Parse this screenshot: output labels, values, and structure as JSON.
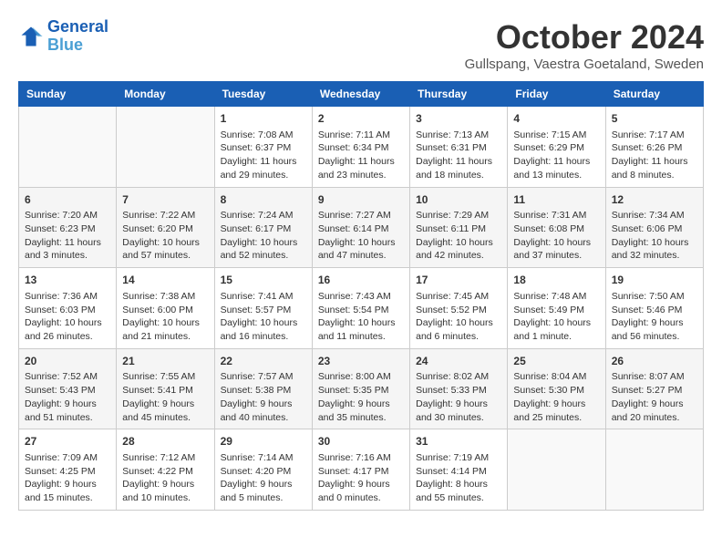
{
  "header": {
    "logo_line1": "General",
    "logo_line2": "Blue",
    "month": "October 2024",
    "location": "Gullspang, Vaestra Goetaland, Sweden"
  },
  "weekdays": [
    "Sunday",
    "Monday",
    "Tuesday",
    "Wednesday",
    "Thursday",
    "Friday",
    "Saturday"
  ],
  "weeks": [
    [
      {
        "day": "",
        "info": ""
      },
      {
        "day": "",
        "info": ""
      },
      {
        "day": "1",
        "info": "Sunrise: 7:08 AM\nSunset: 6:37 PM\nDaylight: 11 hours and 29 minutes."
      },
      {
        "day": "2",
        "info": "Sunrise: 7:11 AM\nSunset: 6:34 PM\nDaylight: 11 hours and 23 minutes."
      },
      {
        "day": "3",
        "info": "Sunrise: 7:13 AM\nSunset: 6:31 PM\nDaylight: 11 hours and 18 minutes."
      },
      {
        "day": "4",
        "info": "Sunrise: 7:15 AM\nSunset: 6:29 PM\nDaylight: 11 hours and 13 minutes."
      },
      {
        "day": "5",
        "info": "Sunrise: 7:17 AM\nSunset: 6:26 PM\nDaylight: 11 hours and 8 minutes."
      }
    ],
    [
      {
        "day": "6",
        "info": "Sunrise: 7:20 AM\nSunset: 6:23 PM\nDaylight: 11 hours and 3 minutes."
      },
      {
        "day": "7",
        "info": "Sunrise: 7:22 AM\nSunset: 6:20 PM\nDaylight: 10 hours and 57 minutes."
      },
      {
        "day": "8",
        "info": "Sunrise: 7:24 AM\nSunset: 6:17 PM\nDaylight: 10 hours and 52 minutes."
      },
      {
        "day": "9",
        "info": "Sunrise: 7:27 AM\nSunset: 6:14 PM\nDaylight: 10 hours and 47 minutes."
      },
      {
        "day": "10",
        "info": "Sunrise: 7:29 AM\nSunset: 6:11 PM\nDaylight: 10 hours and 42 minutes."
      },
      {
        "day": "11",
        "info": "Sunrise: 7:31 AM\nSunset: 6:08 PM\nDaylight: 10 hours and 37 minutes."
      },
      {
        "day": "12",
        "info": "Sunrise: 7:34 AM\nSunset: 6:06 PM\nDaylight: 10 hours and 32 minutes."
      }
    ],
    [
      {
        "day": "13",
        "info": "Sunrise: 7:36 AM\nSunset: 6:03 PM\nDaylight: 10 hours and 26 minutes."
      },
      {
        "day": "14",
        "info": "Sunrise: 7:38 AM\nSunset: 6:00 PM\nDaylight: 10 hours and 21 minutes."
      },
      {
        "day": "15",
        "info": "Sunrise: 7:41 AM\nSunset: 5:57 PM\nDaylight: 10 hours and 16 minutes."
      },
      {
        "day": "16",
        "info": "Sunrise: 7:43 AM\nSunset: 5:54 PM\nDaylight: 10 hours and 11 minutes."
      },
      {
        "day": "17",
        "info": "Sunrise: 7:45 AM\nSunset: 5:52 PM\nDaylight: 10 hours and 6 minutes."
      },
      {
        "day": "18",
        "info": "Sunrise: 7:48 AM\nSunset: 5:49 PM\nDaylight: 10 hours and 1 minute."
      },
      {
        "day": "19",
        "info": "Sunrise: 7:50 AM\nSunset: 5:46 PM\nDaylight: 9 hours and 56 minutes."
      }
    ],
    [
      {
        "day": "20",
        "info": "Sunrise: 7:52 AM\nSunset: 5:43 PM\nDaylight: 9 hours and 51 minutes."
      },
      {
        "day": "21",
        "info": "Sunrise: 7:55 AM\nSunset: 5:41 PM\nDaylight: 9 hours and 45 minutes."
      },
      {
        "day": "22",
        "info": "Sunrise: 7:57 AM\nSunset: 5:38 PM\nDaylight: 9 hours and 40 minutes."
      },
      {
        "day": "23",
        "info": "Sunrise: 8:00 AM\nSunset: 5:35 PM\nDaylight: 9 hours and 35 minutes."
      },
      {
        "day": "24",
        "info": "Sunrise: 8:02 AM\nSunset: 5:33 PM\nDaylight: 9 hours and 30 minutes."
      },
      {
        "day": "25",
        "info": "Sunrise: 8:04 AM\nSunset: 5:30 PM\nDaylight: 9 hours and 25 minutes."
      },
      {
        "day": "26",
        "info": "Sunrise: 8:07 AM\nSunset: 5:27 PM\nDaylight: 9 hours and 20 minutes."
      }
    ],
    [
      {
        "day": "27",
        "info": "Sunrise: 7:09 AM\nSunset: 4:25 PM\nDaylight: 9 hours and 15 minutes."
      },
      {
        "day": "28",
        "info": "Sunrise: 7:12 AM\nSunset: 4:22 PM\nDaylight: 9 hours and 10 minutes."
      },
      {
        "day": "29",
        "info": "Sunrise: 7:14 AM\nSunset: 4:20 PM\nDaylight: 9 hours and 5 minutes."
      },
      {
        "day": "30",
        "info": "Sunrise: 7:16 AM\nSunset: 4:17 PM\nDaylight: 9 hours and 0 minutes."
      },
      {
        "day": "31",
        "info": "Sunrise: 7:19 AM\nSunset: 4:14 PM\nDaylight: 8 hours and 55 minutes."
      },
      {
        "day": "",
        "info": ""
      },
      {
        "day": "",
        "info": ""
      }
    ]
  ]
}
